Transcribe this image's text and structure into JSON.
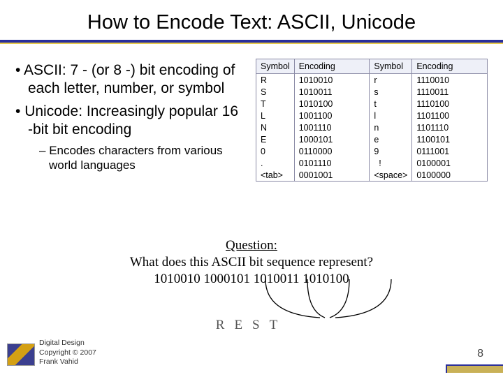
{
  "title": "How to Encode Text: ASCII, Unicode",
  "bullets": {
    "b1": "ASCII: 7 - (or 8 -) bit encoding of each letter, number, or symbol",
    "b2": "Unicode: Increasingly popular 16 -bit bit encoding",
    "sub1": "Encodes characters from various world languages"
  },
  "table": {
    "headers": [
      "Symbol",
      "Encoding",
      "Symbol",
      "Encoding"
    ],
    "rows": [
      [
        "R",
        "1010010",
        "r",
        "1110010"
      ],
      [
        "S",
        "1010011",
        "s",
        "1110011"
      ],
      [
        "T",
        "1010100",
        "t",
        "1110100"
      ],
      [
        "L",
        "1001100",
        "l",
        "1101100"
      ],
      [
        "N",
        "1001110",
        "n",
        "1101110"
      ],
      [
        "E",
        "1000101",
        "e",
        "1100101"
      ],
      [
        "0",
        "0110000",
        "9",
        "0111001"
      ],
      [
        ".",
        "0101110",
        "  !",
        "0100001"
      ],
      [
        "<tab>",
        "0001001",
        "<space>",
        "0100000"
      ]
    ]
  },
  "question": {
    "l1": "Question:",
    "l2": "What does this ASCII bit sequence represent?",
    "l3": "1010010 1000101 1010011 1010100"
  },
  "answer": "REST",
  "footer": {
    "l1": "Digital Design",
    "l2": "Copyright © 2007",
    "l3": "Frank Vahid"
  },
  "page": "8"
}
